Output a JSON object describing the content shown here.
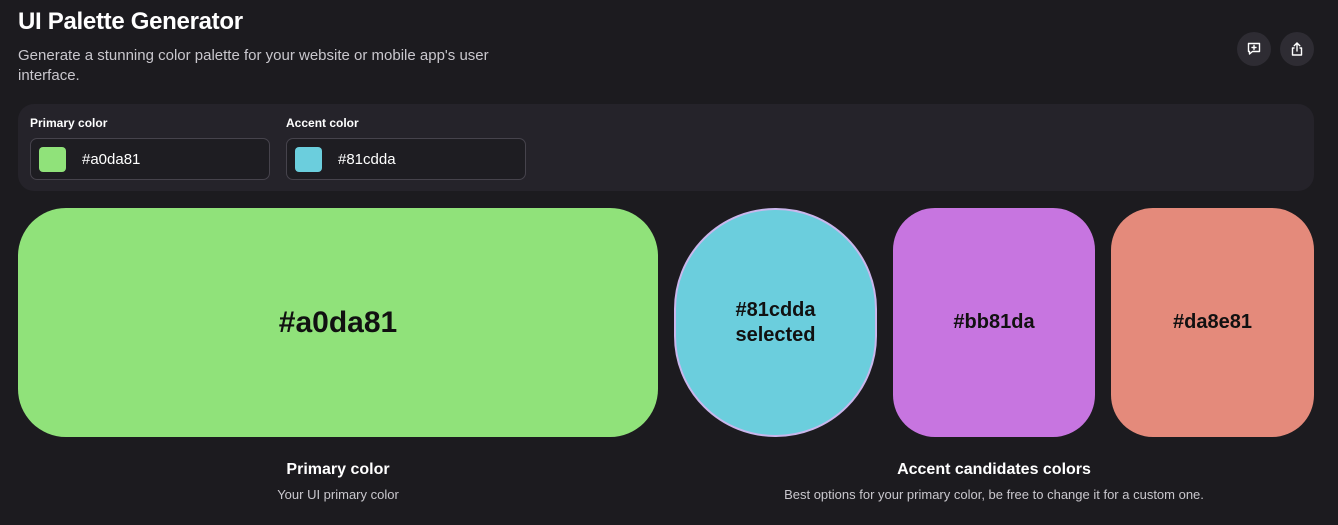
{
  "header": {
    "title": "UI Palette Generator",
    "subtitle": "Generate a stunning color palette for your website or mobile app's user interface.",
    "actions": [
      {
        "icon": "feedback-icon"
      },
      {
        "icon": "share-icon"
      }
    ]
  },
  "inputs": {
    "primary": {
      "label": "Primary color",
      "value": "#a0da81",
      "swatch_color": "#90e27a"
    },
    "accent": {
      "label": "Accent color",
      "value": "#81cdda",
      "swatch_color": "#6bcedd"
    }
  },
  "preview": {
    "primary": {
      "hex": "#a0da81",
      "color": "#90e27a"
    },
    "accents": [
      {
        "hex": "#81cdda",
        "status": "selected",
        "color": "#6bcedd"
      },
      {
        "hex": "#bb81da",
        "color": "#c775e0"
      },
      {
        "hex": "#da8e81",
        "color": "#e48a7b"
      }
    ]
  },
  "captions": {
    "primary": {
      "title": "Primary color",
      "subtitle": "Your UI primary color"
    },
    "accent": {
      "title": "Accent candidates colors",
      "subtitle": "Best options for your primary color, be free to change it for a custom one."
    }
  }
}
